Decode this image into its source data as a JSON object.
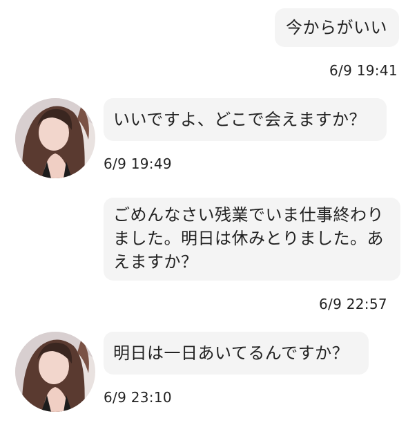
{
  "messages": [
    {
      "side": "outgoing",
      "text": "今からがいい",
      "time": "6/9 19:41"
    },
    {
      "side": "incoming",
      "text": "いいですよ、どこで会えますか？",
      "time": "6/9 19:49"
    },
    {
      "side": "incoming",
      "text": "ごめんなさい残業でいま仕事終わりました。明日は休みとりました。あえますか？",
      "time": "6/9 22:57"
    },
    {
      "side": "incoming",
      "text": "明日は一日あいてるんですか？",
      "time": "6/9 23:10"
    }
  ],
  "colors": {
    "bubble": "#f4f4f4",
    "text": "#222222",
    "background": "#ffffff"
  },
  "icons": {
    "contact_avatar": "avatar-photo-icon"
  }
}
